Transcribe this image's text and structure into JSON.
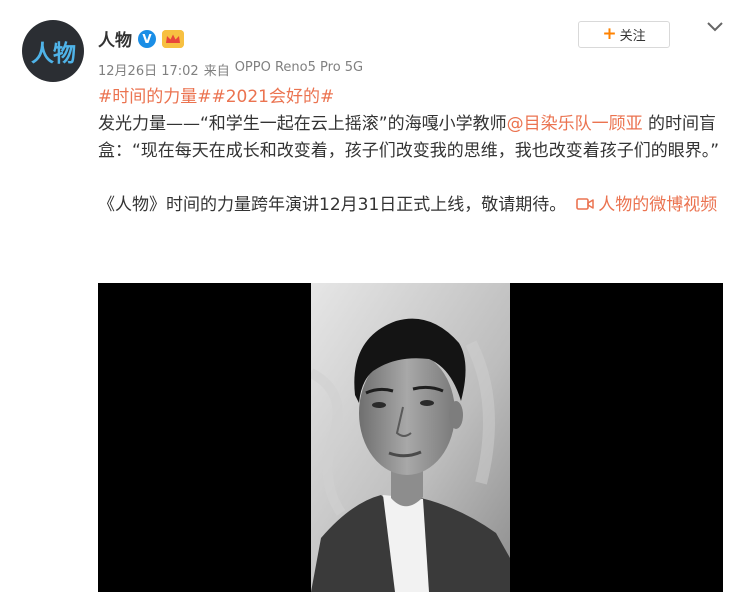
{
  "author": {
    "avatar_logo_text": "人物",
    "name": "人物",
    "verified_badge": "V",
    "member_badge": "会员"
  },
  "follow_button": {
    "plus": "+",
    "label": "关注"
  },
  "meta": {
    "date": "12月26日 17:02",
    "source_prefix": "来自",
    "source": "OPPO Reno5 Pro 5G"
  },
  "post": {
    "hashtags": "#时间的力量##2021会好的#",
    "line1_prefix": "发光力量——“和学生一起在云上摇滚”的海嘎小学教师",
    "mention": "@目染乐队一顾亚",
    "line1_suffix": " 的时间盲盒：“现在每天在成长和改变着，孩子们改变我的思维，我也改变着孩子们的眼界。”",
    "line2": "《人物》时间的力量跨年演讲12月31日正式上线，敬请期待。",
    "video_link": "人物的微博视频"
  },
  "icons": {
    "verified": "verified-icon",
    "member": "member-crown-icon",
    "more": "chevron-down-icon",
    "video": "video-camera-icon"
  },
  "colors": {
    "link": "#eb7350",
    "follow_plus": "#ff8200",
    "verified_blue": "#1a8ee6",
    "meta_gray": "#808080",
    "avatar_text": "#4fb3e8"
  }
}
